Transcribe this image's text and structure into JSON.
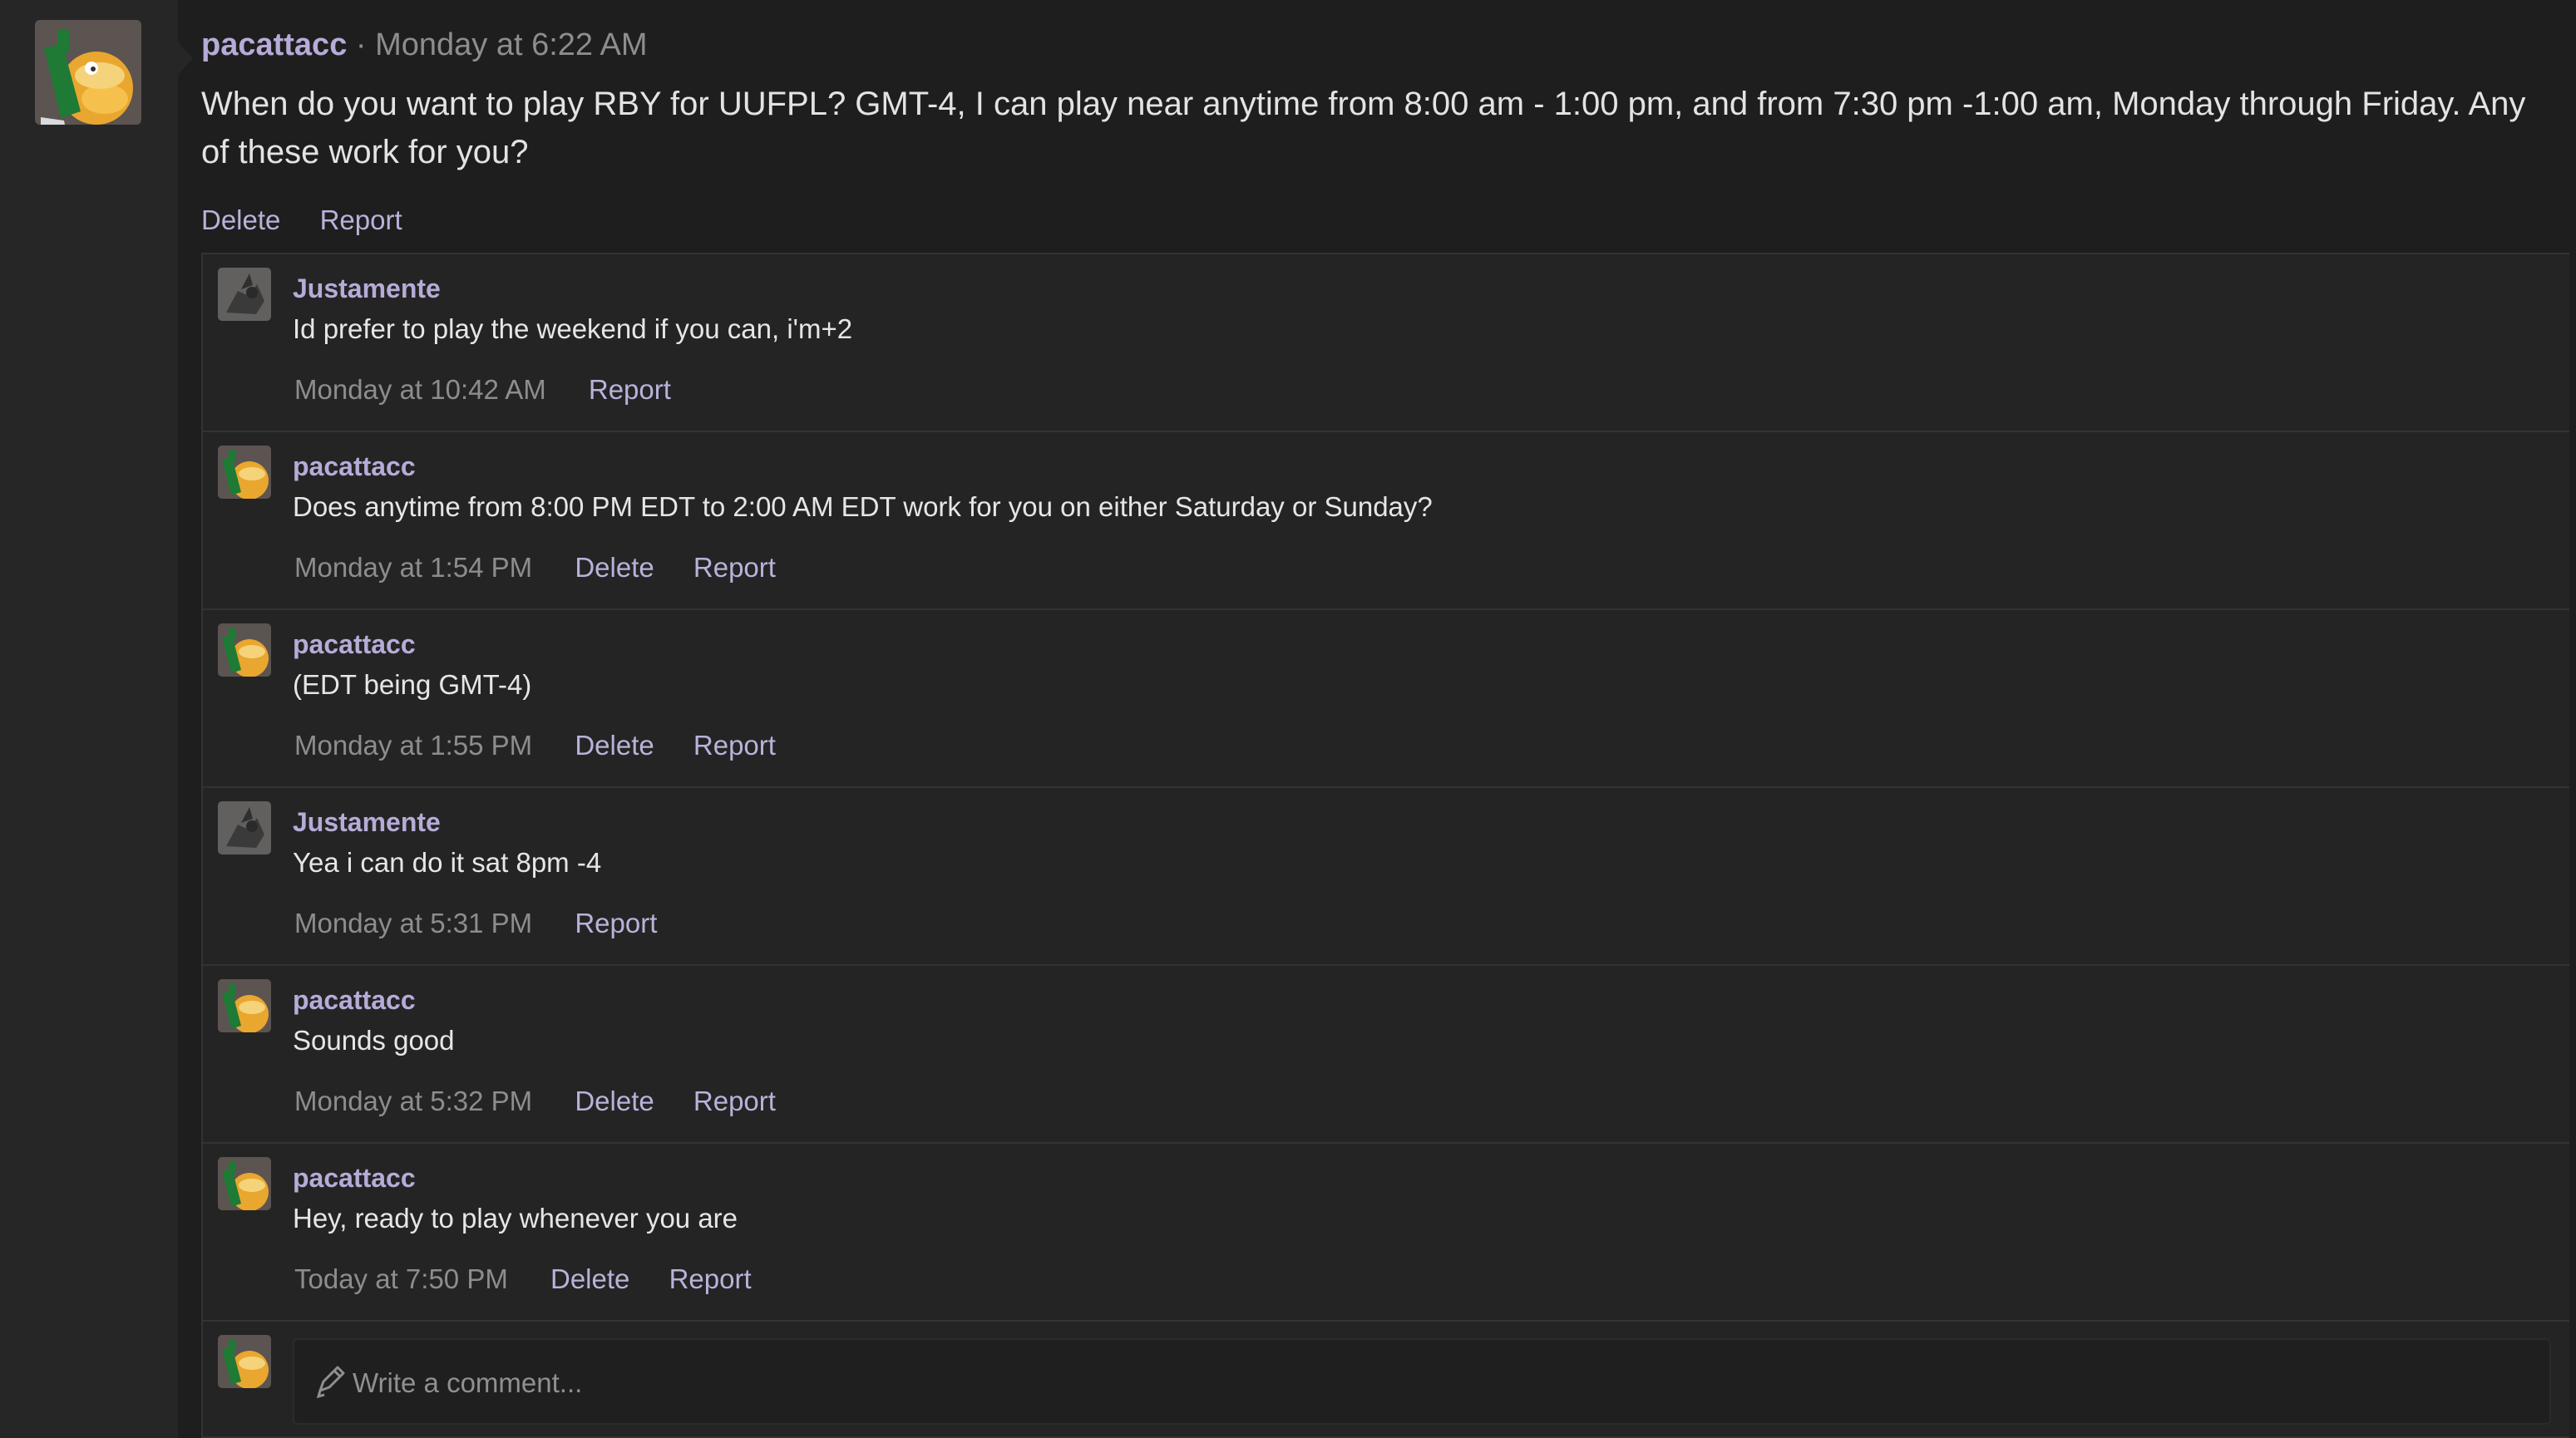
{
  "post": {
    "author": "pacattacc",
    "separator": "·",
    "time": "Monday at 6:22 AM",
    "body": "When do you want to play RBY for UUFPL? GMT-4, I can play near anytime from 8:00 am - 1:00 pm, and from 7:30 pm -1:00 am, Monday through Friday. Any of these work for you?",
    "delete_label": "Delete",
    "report_label": "Report"
  },
  "comments": [
    {
      "author": "Justamente",
      "text": "Id prefer to play the weekend if you can, i'm+2",
      "time": "Monday at 10:42 AM",
      "report_label": "Report"
    },
    {
      "author": "pacattacc",
      "text": "Does anytime from 8:00 PM EDT to 2:00 AM EDT work for you on either Saturday or Sunday?",
      "time": "Monday at 1:54 PM",
      "delete_label": "Delete",
      "report_label": "Report"
    },
    {
      "author": "pacattacc",
      "text": "(EDT being GMT-4)",
      "time": "Monday at 1:55 PM",
      "delete_label": "Delete",
      "report_label": "Report"
    },
    {
      "author": "Justamente",
      "text": "Yea i can do it sat 8pm -4",
      "time": "Monday at 5:31 PM",
      "report_label": "Report"
    },
    {
      "author": "pacattacc",
      "text": "Sounds good",
      "time": "Monday at 5:32 PM",
      "delete_label": "Delete",
      "report_label": "Report"
    },
    {
      "author": "pacattacc",
      "text": "Hey, ready to play whenever you are",
      "time": "Today at 7:50 PM",
      "delete_label": "Delete",
      "report_label": "Report"
    }
  ],
  "composer": {
    "placeholder": "Write a comment..."
  },
  "icons": {
    "pacattacc_avatar": "psyduck-avatar-icon",
    "justamente_avatar": "dark-creature-avatar-icon",
    "pencil": "pencil-icon"
  },
  "colors": {
    "background": "#1e1e1e",
    "sidebar": "#262626",
    "author": "#b7abd8",
    "link": "#b9b2da",
    "muted": "#8d8d8d"
  }
}
